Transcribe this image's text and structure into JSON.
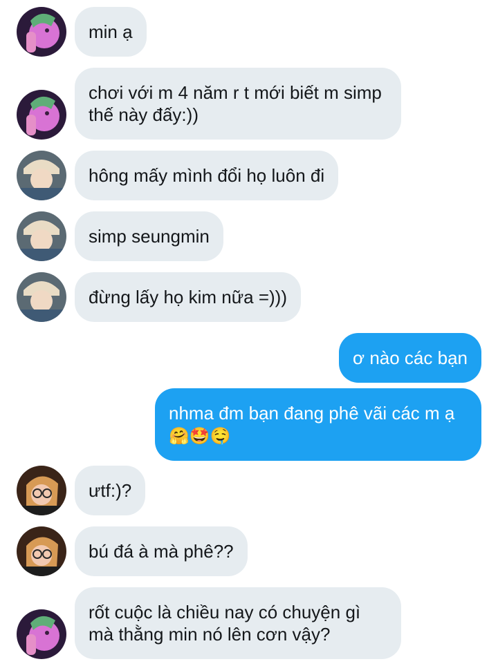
{
  "conversation": {
    "messages": [
      {
        "id": "m1",
        "side": "in",
        "avatar": "purple-avatar",
        "text": "min ạ"
      },
      {
        "id": "m2",
        "side": "in",
        "avatar": "purple-avatar",
        "text": "chơi với m 4 năm r t mới biết m simp thế này đấy:))"
      },
      {
        "id": "m3",
        "side": "in",
        "avatar": "beige-hat-avatar",
        "text": "hông mấy mình đổi họ luôn đi"
      },
      {
        "id": "m4",
        "side": "in",
        "avatar": "beige-hat-avatar",
        "text": "simp seungmin"
      },
      {
        "id": "m5",
        "side": "in",
        "avatar": "beige-hat-avatar",
        "text": "đừng lấy họ kim nữa =)))"
      },
      {
        "id": "m6",
        "side": "out",
        "text": "ơ nào các bạn"
      },
      {
        "id": "m7",
        "side": "out",
        "text": "nhma đm bạn đang phê vãi các m ạ",
        "emojis": "🤗🤩🤤"
      },
      {
        "id": "m8",
        "side": "in",
        "avatar": "glasses-avatar",
        "text": "ưtf:)?"
      },
      {
        "id": "m9",
        "side": "in",
        "avatar": "glasses-avatar",
        "text": "bú đá à mà phê??"
      },
      {
        "id": "m10",
        "side": "in",
        "avatar": "purple-avatar",
        "text": "rốt cuộc là chiều nay có chuyện gì mà thằng min nó lên cơn vậy?"
      }
    ]
  }
}
